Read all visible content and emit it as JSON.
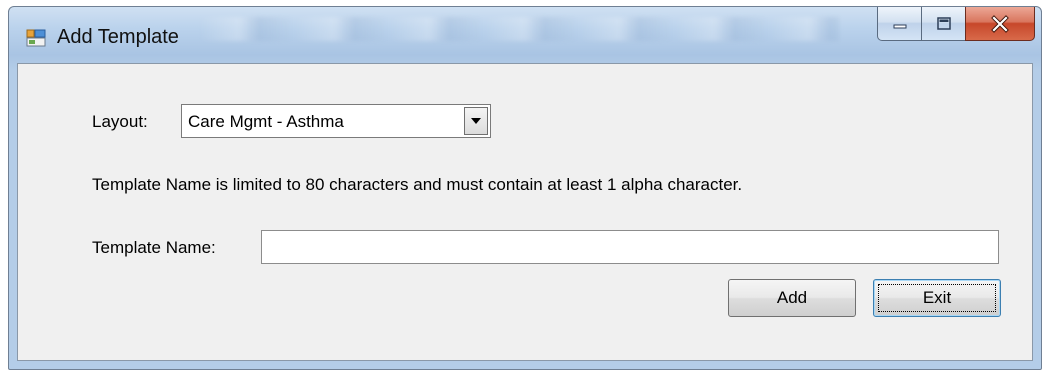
{
  "window": {
    "title": "Add Template",
    "icon": "app-window-icon",
    "caption_buttons": [
      "minimize-icon",
      "maximize-icon",
      "close-icon"
    ],
    "close_color": "#c7472a"
  },
  "form": {
    "layout_label": "Layout:",
    "layout_value": "Care Mgmt - Asthma",
    "hint": "Template Name is limited to 80 characters and must contain at least 1 alpha character.",
    "template_name_label": "Template Name:",
    "template_name_value": ""
  },
  "buttons": {
    "add_label": "Add",
    "exit_label": "Exit"
  }
}
